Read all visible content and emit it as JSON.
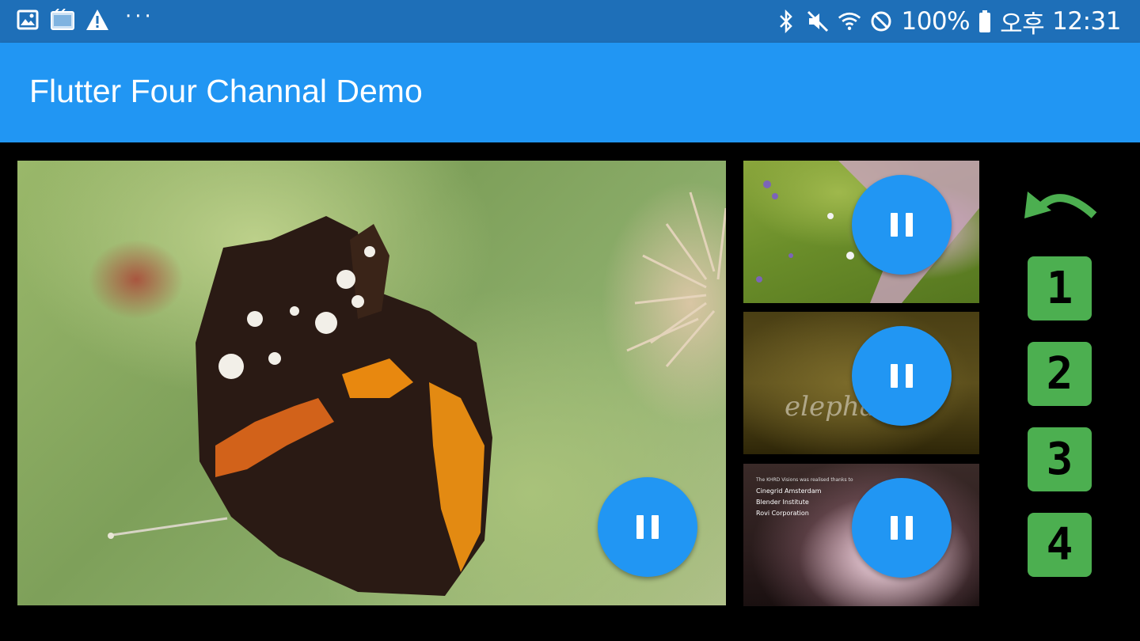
{
  "status_bar": {
    "battery": "100%",
    "ampm": "오후",
    "time": "12:31",
    "more": "···",
    "left_icons": [
      "image-icon",
      "screen-cast-icon",
      "warning-icon"
    ],
    "right_icons": [
      "bluetooth-icon",
      "mute-icon",
      "wifi-icon",
      "no-signal-icon",
      "battery-icon"
    ]
  },
  "app_bar": {
    "title": "Flutter Four Channal Demo"
  },
  "videos": {
    "main": {
      "subject": "butterfly"
    },
    "ch2_text": "elephants",
    "ch3_credits": {
      "line0": "The KHRD Visions was realised thanks to",
      "line1": "Cinegrid Amsterdam",
      "line2": "Blender Institute",
      "line3": "Rovi Corporation"
    }
  },
  "controls": {
    "back_icon": "undo-icon",
    "channels": [
      "1",
      "2",
      "3",
      "4"
    ]
  },
  "colors": {
    "status_bar": "#1e6fb8",
    "app_bar": "#2196f3",
    "fab": "#2196f3",
    "channel_button": "#4caf50",
    "undo": "#4caf50",
    "background": "#000000"
  }
}
